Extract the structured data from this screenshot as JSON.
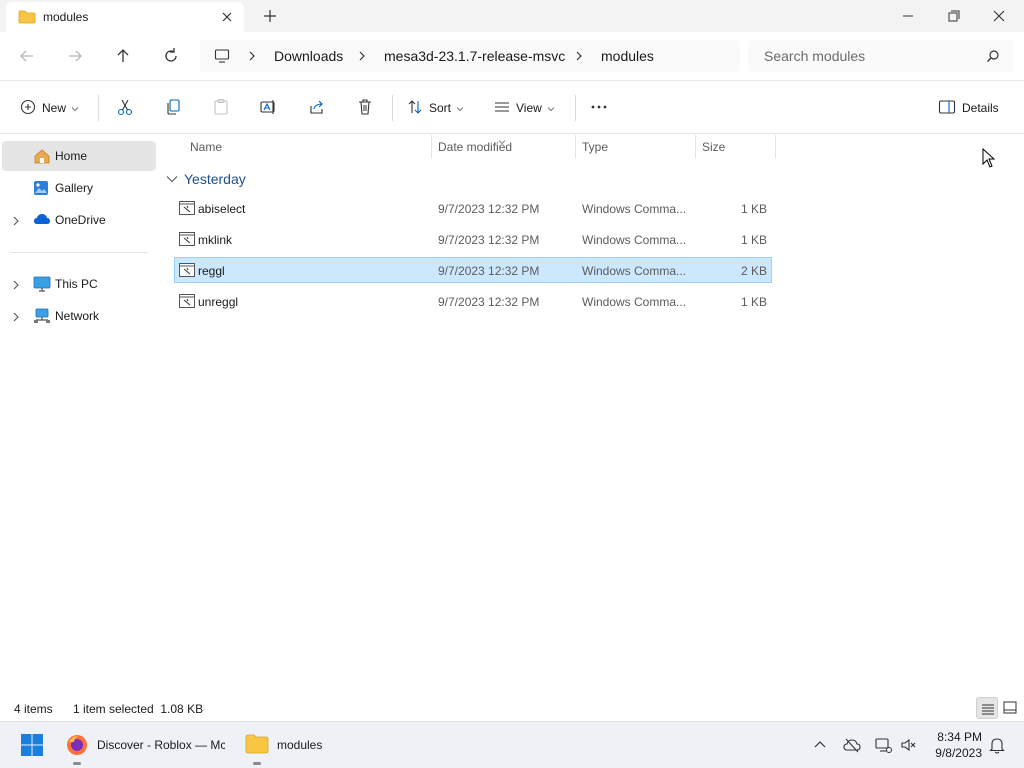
{
  "window": {
    "tab_title": "modules",
    "new_tab_symbol": "+"
  },
  "address": {
    "breadcrumbs": [
      "Downloads",
      "mesa3d-23.1.7-release-msvc",
      "modules"
    ],
    "search_placeholder": "Search modules"
  },
  "commands": {
    "new": "New",
    "sort": "Sort",
    "view": "View",
    "more": "···",
    "details": "Details"
  },
  "nav": {
    "items": [
      {
        "label": "Home",
        "icon": "home-icon",
        "selected": true,
        "expandable": false
      },
      {
        "label": "Gallery",
        "icon": "gallery-icon",
        "selected": false,
        "expandable": false
      },
      {
        "label": "OneDrive",
        "icon": "cloud-icon",
        "selected": false,
        "expandable": true
      },
      {
        "label": "This PC",
        "icon": "monitor-icon",
        "selected": false,
        "expandable": true
      },
      {
        "label": "Network",
        "icon": "network-icon",
        "selected": false,
        "expandable": true
      }
    ]
  },
  "columns": {
    "name": "Name",
    "date": "Date modified",
    "type": "Type",
    "size": "Size"
  },
  "group": {
    "label": "Yesterday"
  },
  "files": [
    {
      "name": "abiselect",
      "date": "9/7/2023 12:32 PM",
      "type": "Windows Comma...",
      "size": "1 KB",
      "selected": false
    },
    {
      "name": "mklink",
      "date": "9/7/2023 12:32 PM",
      "type": "Windows Comma...",
      "size": "1 KB",
      "selected": false
    },
    {
      "name": "reggl",
      "date": "9/7/2023 12:32 PM",
      "type": "Windows Comma...",
      "size": "2 KB",
      "selected": true
    },
    {
      "name": "unreggl",
      "date": "9/7/2023 12:32 PM",
      "type": "Windows Comma...",
      "size": "1 KB",
      "selected": false
    }
  ],
  "status": {
    "count": "4 items",
    "selection": "1 item selected  1.08 KB"
  },
  "taskbar": {
    "apps": [
      {
        "label": "Discover - Roblox — Mc",
        "icon": "firefox-icon"
      },
      {
        "label": "modules",
        "icon": "folder-icon"
      }
    ],
    "time": "8:34 PM",
    "date": "9/8/2023"
  },
  "colors": {
    "selection_bg": "#cce8ff",
    "selection_border": "#99d1ff",
    "accent": "#0067c0",
    "folder": "#f8c642"
  }
}
